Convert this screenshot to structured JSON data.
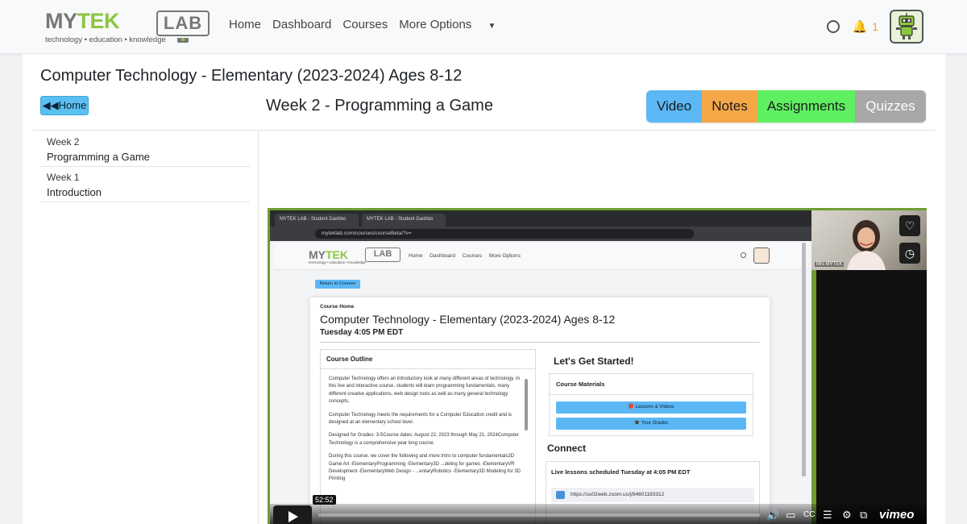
{
  "navbar": {
    "logo": {
      "my": "MY",
      "tek": "TEK",
      "lab": "LAB",
      "tagline": "technology • education • knowledge"
    },
    "links": [
      "Home",
      "Dashboard",
      "Courses",
      "More Options"
    ],
    "notification_count": "1",
    "colors": {
      "brand_green": "#8cc63f",
      "bell": "#f0a030"
    }
  },
  "page": {
    "course_title": "Computer Technology - Elementary (2023-2024) Ages 8-12",
    "home_button": "Home",
    "week_title": "Week 2 - Programming a Game",
    "tabs": [
      {
        "label": "Video",
        "color": "#5bb8f5"
      },
      {
        "label": "Notes",
        "color": "#f5a748"
      },
      {
        "label": "Assignments",
        "color": "#5ff062"
      },
      {
        "label": "Quizzes",
        "color": "#a8a8a8"
      }
    ]
  },
  "sidebar": {
    "items": [
      {
        "week": "Week 2",
        "name": "Programming a Game"
      },
      {
        "week": "Week 1",
        "name": "Introduction"
      }
    ]
  },
  "video": {
    "browser_tabs": [
      "MYTEK LAB - Student Dashbo",
      "MYTEK LAB - Student Dashbo"
    ],
    "url": "myteklab.com/courses/courseBeta/?v=",
    "inner_nav": {
      "links": [
        "Home",
        "Dashboard",
        "Courses",
        "More Options"
      ],
      "logo_tagline": "technology • education • knowledge"
    },
    "return_button": "Return to Courses",
    "card": {
      "breadcrumb": "Course Home",
      "title": "Computer Technology - Elementary (2023-2024) Ages 8-12",
      "time": "Tuesday 4:05 PM EDT",
      "outline_title": "Course Outline",
      "outline_paragraphs": [
        "Computer Technology offers an introductory look at many different areas of technology. In this live and interactive course, students will learn programming fundamentals, many different creative applications, web design tools as well as many general technology concepts.",
        " Computer Technology meets the requirements for a Computer Education credit and is designed at an elementary school level.",
        "Designed for Grades: 3-5Course dates: August 22, 2023 through May 21, 2024Computer Technology is a comprehensive year long course.",
        "During this course, we cover the following and more:Intro to computer fundamentals2D Game Art -ElementaryProgramming -Elementary3D ...deling for games -ElementaryVR Development -ElementaryWeb Design - ...entaryRobotics -Elementary3D Modeling for 3D Printing"
      ],
      "lets_get_started": "Let's Get Started!",
      "materials_title": "Course Materials",
      "materials_buttons": [
        "📕 Lessons & Videos",
        "🎓 Your Grades"
      ],
      "connect_title": "Connect",
      "live_text_prefix": "Live lessons scheduled ",
      "live_text_bold": "Tuesday",
      "live_text_suffix": " at 4:05 PM EDT",
      "zoom_link": "https://us02web.zoom.us/j/84601183312"
    },
    "webcam_label": "Mrs MYTEK",
    "timestamp": "52:52",
    "progress_fraction": 0.0,
    "brand": "vimeo",
    "frame_color": "#6d9e33"
  }
}
